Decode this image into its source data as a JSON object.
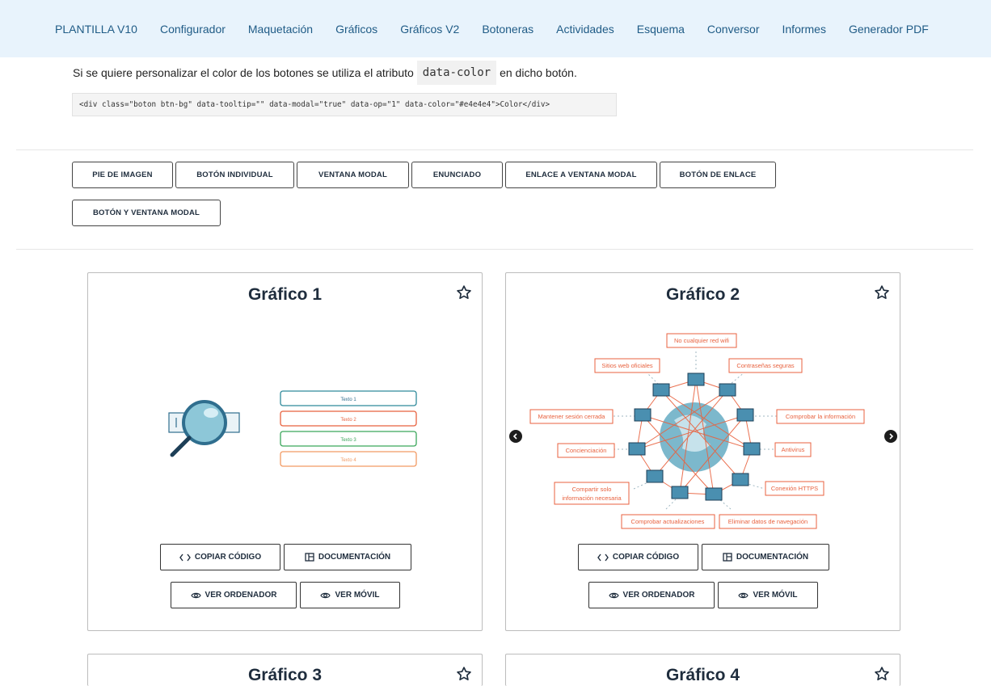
{
  "nav": {
    "items": [
      "PLANTILLA V10",
      "Configurador",
      "Maquetación",
      "Gráficos",
      "Gráficos V2",
      "Botoneras",
      "Actividades",
      "Esquema",
      "Conversor",
      "Informes",
      "Generador PDF"
    ]
  },
  "intro": {
    "text_before": "Si se quiere personalizar el color de los botones se utiliza el atributo",
    "code": "data-color",
    "text_after": "en dicho botón."
  },
  "code_example": "<div class=\"boton btn-bg\"  data-tooltip=\"\" data-modal=\"true\" data-op=\"1\" data-color=\"#e4e4e4\">Color</div>",
  "demo_buttons": [
    "PIE DE IMAGEN",
    "BOTÓN INDIVIDUAL",
    "VENTANA MODAL",
    "ENUNCIADO",
    "ENLACE A VENTANA MODAL",
    "BOTÓN DE ENLACE",
    "BOTÓN Y VENTANA MODAL"
  ],
  "cards": [
    {
      "title": "Gráfico 1",
      "copy_label": "COPIAR CÓDIGO",
      "docs_label": "DOCUMENTACIÓN",
      "desktop_label": "VER ORDENADOR",
      "mobile_label": "VER MÓVIL",
      "image_texts": [
        "Texto 1",
        "Texto 2",
        "Texto 3",
        "Texto 4"
      ]
    },
    {
      "title": "Gráfico 2",
      "copy_label": "COPIAR CÓDIGO",
      "docs_label": "DOCUMENTACIÓN",
      "desktop_label": "VER ORDENADOR",
      "mobile_label": "VER MÓVIL",
      "image_texts": [
        "No cualquier red wifi",
        "Sitios web oficiales",
        "Contraseñas seguras",
        "Mantener sesión cerrada",
        "Comprobar la información",
        "Concienciación",
        "Antivirus",
        "Compartir solo",
        "información necesaria",
        "Conexión HTTPS",
        "Comprobar actualizaciones",
        "Eliminar datos de navegación"
      ]
    },
    {
      "title": "Gráfico 3"
    },
    {
      "title": "Gráfico 4"
    }
  ],
  "colors": {
    "nav_bg": "#e8f3fc",
    "nav_link": "#1f5b86",
    "teal": "#2f8a9b",
    "orange": "#e8623f",
    "green": "#3aa65a",
    "light_orange": "#f29a63"
  }
}
